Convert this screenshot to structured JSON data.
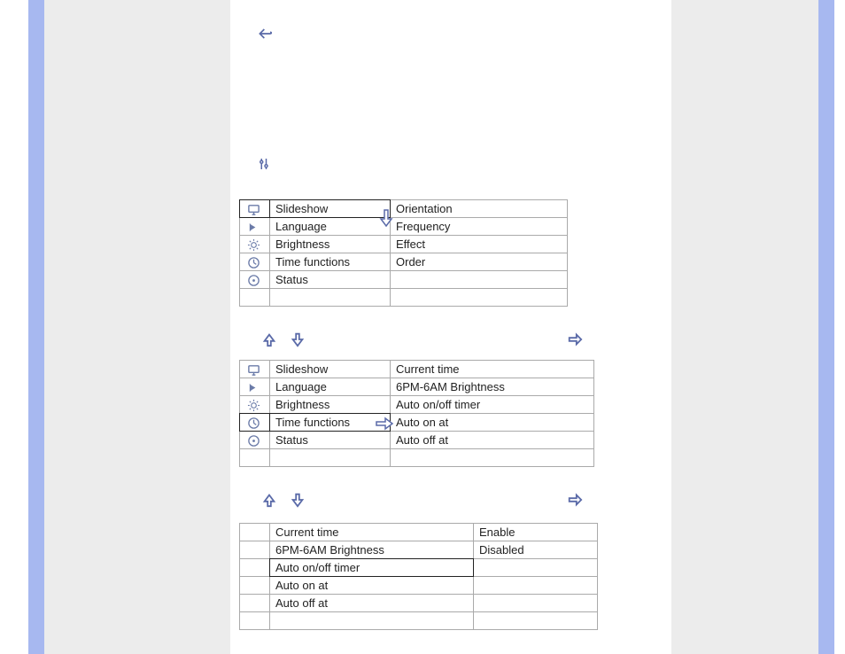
{
  "icons": {
    "back": "back-arrow-icon",
    "settings": "settings-sliders-icon",
    "up": "up-arrow-icon",
    "down": "down-arrow-icon",
    "right": "right-arrow-icon",
    "pointer_down": "select-down-icon",
    "pointer_right": "select-right-icon"
  },
  "table1": {
    "left": [
      {
        "icon": "monitor-icon",
        "label": "Slideshow"
      },
      {
        "icon": "flag-icon",
        "label": "Language"
      },
      {
        "icon": "sun-icon",
        "label": "Brightness"
      },
      {
        "icon": "clock-icon",
        "label": "Time functions"
      },
      {
        "icon": "status-icon",
        "label": "Status"
      },
      {
        "icon": "",
        "label": ""
      }
    ],
    "right": [
      "Orientation",
      "Frequency",
      "Effect",
      "Order",
      "",
      ""
    ],
    "selected_left_index": 0
  },
  "table2": {
    "left": [
      {
        "icon": "monitor-icon",
        "label": "Slideshow"
      },
      {
        "icon": "flag-icon",
        "label": "Language"
      },
      {
        "icon": "sun-icon",
        "label": "Brightness"
      },
      {
        "icon": "clock-icon",
        "label": "Time functions"
      },
      {
        "icon": "status-icon",
        "label": "Status"
      },
      {
        "icon": "",
        "label": ""
      }
    ],
    "right": [
      "Current time",
      "6PM-6AM Brightness",
      "Auto on/off timer",
      "Auto on at",
      "Auto off at",
      ""
    ],
    "selected_left_index": 3
  },
  "table3": {
    "left": [
      "Current time",
      "6PM-6AM Brightness",
      "Auto on/off timer",
      "Auto on at",
      "Auto off at",
      ""
    ],
    "right": [
      "Enable",
      "Disabled",
      "",
      "",
      "",
      ""
    ],
    "selected_left_index": 2
  }
}
